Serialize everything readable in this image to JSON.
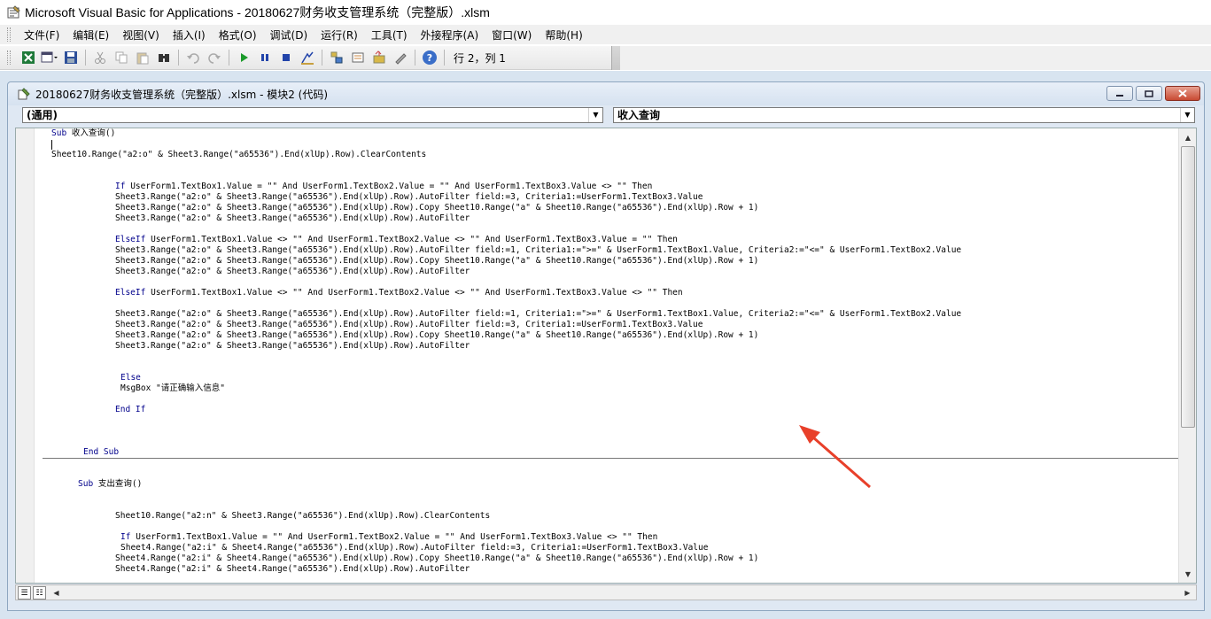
{
  "app": {
    "title": "Microsoft Visual Basic for Applications - 20180627财务收支管理系统（完整版）.xlsm"
  },
  "menu": [
    "文件(F)",
    "编辑(E)",
    "视图(V)",
    "插入(I)",
    "格式(O)",
    "调试(D)",
    "运行(R)",
    "工具(T)",
    "外接程序(A)",
    "窗口(W)",
    "帮助(H)"
  ],
  "toolbar": {
    "cursor_position": "行 2，列 1",
    "icons": [
      "excel-icon",
      "insert-userform-icon",
      "save-icon",
      "cut-icon",
      "copy-icon",
      "paste-icon",
      "find-icon",
      "undo-icon",
      "redo-icon",
      "run-icon",
      "break-icon",
      "reset-icon",
      "design-mode-icon",
      "project-explorer-icon",
      "properties-icon",
      "object-browser-icon",
      "toolbox-icon",
      "help-icon"
    ]
  },
  "code_window": {
    "title": "20180627财务收支管理系统（完整版）.xlsm - 模块2 (代码)",
    "object_dropdown": "(通用)",
    "procedure_dropdown": "收入查询",
    "lines": [
      "Sub 收入查询()",
      "Sheet10.Range(\"a2:o\" & Sheet3.Range(\"a65536\").End(xlUp).Row).ClearContents",
      "If UserForm1.TextBox1.Value = \"\" And UserForm1.TextBox2.Value = \"\" And UserForm1.TextBox3.Value <> \"\" Then",
      "Sheet3.Range(\"a2:o\" & Sheet3.Range(\"a65536\").End(xlUp).Row).AutoFilter field:=3, Criteria1:=UserForm1.TextBox3.Value",
      "Sheet3.Range(\"a2:o\" & Sheet3.Range(\"a65536\").End(xlUp).Row).Copy Sheet10.Range(\"a\" & Sheet10.Range(\"a65536\").End(xlUp).Row + 1)",
      "Sheet3.Range(\"a2:o\" & Sheet3.Range(\"a65536\").End(xlUp).Row).AutoFilter",
      "ElseIf UserForm1.TextBox1.Value <> \"\" And UserForm1.TextBox2.Value <> \"\" And UserForm1.TextBox3.Value = \"\" Then",
      "Sheet3.Range(\"a2:o\" & Sheet3.Range(\"a65536\").End(xlUp).Row).AutoFilter field:=1, Criteria1:=\">=\" & UserForm1.TextBox1.Value, Criteria2:=\"<=\" & UserForm1.TextBox2.Value",
      "Sheet3.Range(\"a2:o\" & Sheet3.Range(\"a65536\").End(xlUp).Row).Copy Sheet10.Range(\"a\" & Sheet10.Range(\"a65536\").End(xlUp).Row + 1)",
      "Sheet3.Range(\"a2:o\" & Sheet3.Range(\"a65536\").End(xlUp).Row).AutoFilter",
      "ElseIf UserForm1.TextBox1.Value <> \"\" And UserForm1.TextBox2.Value <> \"\" And UserForm1.TextBox3.Value <> \"\" Then",
      "Sheet3.Range(\"a2:o\" & Sheet3.Range(\"a65536\").End(xlUp).Row).AutoFilter field:=1, Criteria1:=\">=\" & UserForm1.TextBox1.Value, Criteria2:=\"<=\" & UserForm1.TextBox2.Value",
      "Sheet3.Range(\"a2:o\" & Sheet3.Range(\"a65536\").End(xlUp).Row).AutoFilter field:=3, Criteria1:=UserForm1.TextBox3.Value",
      "Sheet3.Range(\"a2:o\" & Sheet3.Range(\"a65536\").End(xlUp).Row).Copy Sheet10.Range(\"a\" & Sheet10.Range(\"a65536\").End(xlUp).Row + 1)",
      "Sheet3.Range(\"a2:o\" & Sheet3.Range(\"a65536\").End(xlUp).Row).AutoFilter",
      "Else",
      "MsgBox \"请正确输入信息\"",
      "End If",
      "End Sub",
      "Sub 支出查询()",
      "Sheet10.Range(\"a2:n\" & Sheet3.Range(\"a65536\").End(xlUp).Row).ClearContents",
      "If UserForm1.TextBox1.Value = \"\" And UserForm1.TextBox2.Value = \"\" And UserForm1.TextBox3.Value <> \"\" Then",
      "Sheet4.Range(\"a2:i\" & Sheet4.Range(\"a65536\").End(xlUp).Row).AutoFilter field:=3, Criteria1:=UserForm1.TextBox3.Value",
      "Sheet4.Range(\"a2:i\" & Sheet4.Range(\"a65536\").End(xlUp).Row).Copy Sheet10.Range(\"a\" & Sheet10.Range(\"a65536\").End(xlUp).Row + 1)",
      "Sheet4.Range(\"a2:i\" & Sheet4.Range(\"a65536\").End(xlUp).Row).AutoFilter"
    ]
  },
  "colors": {
    "keyword": "#00008b",
    "annotation_arrow": "#e8402a"
  }
}
